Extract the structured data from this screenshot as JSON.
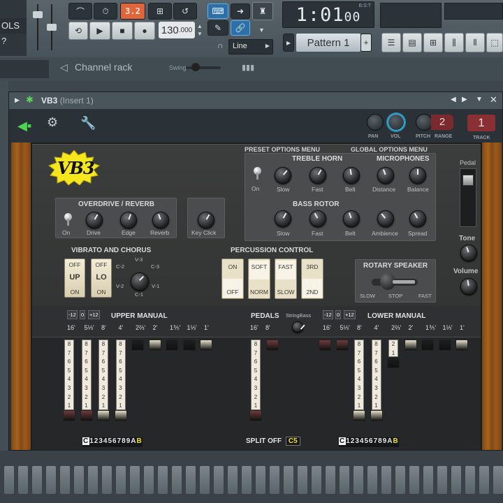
{
  "toolbar": {
    "mode_text": "OLS ?",
    "tempo_value": "130",
    "tempo_decimal": ".000",
    "pattern_label": "Pattern 1",
    "pattern_add": "+",
    "time_display": "1:01",
    "time_sub": "00",
    "time_unit_label": "B:S:T",
    "snap_label": "Line",
    "counter_btn": "3.2"
  },
  "channel_rack": {
    "title": "Channel rack",
    "swing_label": "Swing"
  },
  "plugin": {
    "name": "VB3",
    "insert": "(Insert 1)",
    "header_labels": {
      "pan": "PAN",
      "vol": "VOL",
      "pitch": "PITCH",
      "range": "RANGE",
      "track": "TRACK"
    },
    "range_value": "2",
    "track_value": "1"
  },
  "vb3": {
    "logo_text": "VB3",
    "preset_menu": "PRESET OPTIONS MENU",
    "global_menu": "GLOBAL OPTIONS MENU",
    "treble_horn": "TREBLE HORN",
    "microphones": "MICROPHONES",
    "bass_rotor": "BASS ROTOR",
    "overdrive": "OVERDRIVE / REVERB",
    "vibrato": "VIBRATO AND CHORUS",
    "percussion": "PERCUSSION CONTROL",
    "rotary": "ROTARY SPEAKER",
    "pedal_label": "Pedal",
    "tone_label": "Tone",
    "volume_label": "Volume",
    "knobs": {
      "th_slow": "Slow",
      "th_fast": "Fast",
      "th_belt": "Belt",
      "mic_distance": "Distance",
      "mic_balance": "Balance",
      "br_slow": "Slow",
      "br_fast": "Fast",
      "br_belt": "Belt",
      "br_ambience": "Ambience",
      "br_spread": "Spread",
      "od_drive": "Drive",
      "od_edge": "Edge",
      "od_reverb": "Reverb",
      "key_click": "Key Click",
      "on_label": "On"
    },
    "vibrato_switches": [
      {
        "top": "OFF",
        "mid": "UP",
        "bot": "ON"
      },
      {
        "top": "OFF",
        "mid": "LO",
        "bot": "ON"
      }
    ],
    "vibrato_positions": {
      "c2": "C-2",
      "v3": "V-3",
      "c3": "C-3",
      "v2": "V-2",
      "v1": "V-1",
      "c1": "C-1"
    },
    "percussion_switches": [
      {
        "top": "ON",
        "bot": "OFF"
      },
      {
        "top": "SOFT",
        "bot": "NORM"
      },
      {
        "top": "FAST",
        "bot": "SLOW"
      },
      {
        "top": "3RD",
        "bot": "2ND"
      }
    ],
    "rotary_labels": {
      "slow": "SLOW",
      "stop": "STOP",
      "fast": "FAST"
    },
    "upper_manual": "UPPER MANUAL",
    "lower_manual": "LOWER MANUAL",
    "pedals": "PEDALS",
    "string_bass": "StringBass",
    "transpose": [
      "-12",
      "0",
      "+12"
    ],
    "footages": [
      "16'",
      "5⅓'",
      "8'",
      "4'",
      "2⅔'",
      "2'",
      "1⅗'",
      "1⅓'",
      "1'"
    ],
    "pedal_footages": [
      "16'",
      "8'"
    ],
    "drawbar_numbers": [
      "8",
      "7",
      "6",
      "5",
      "4",
      "3",
      "2",
      "1"
    ],
    "upper_bars": [
      8,
      8,
      8,
      8,
      0,
      0,
      0,
      0,
      0
    ],
    "lower_bars": [
      0,
      0,
      8,
      8,
      2,
      0,
      0,
      0,
      0
    ],
    "pedal_bars": [
      8,
      0
    ],
    "preset_keys": [
      "C",
      "1",
      "2",
      "3",
      "4",
      "5",
      "6",
      "7",
      "8",
      "9",
      "A",
      "B"
    ],
    "split_label": "SPLIT OFF",
    "split_note": "C5"
  }
}
